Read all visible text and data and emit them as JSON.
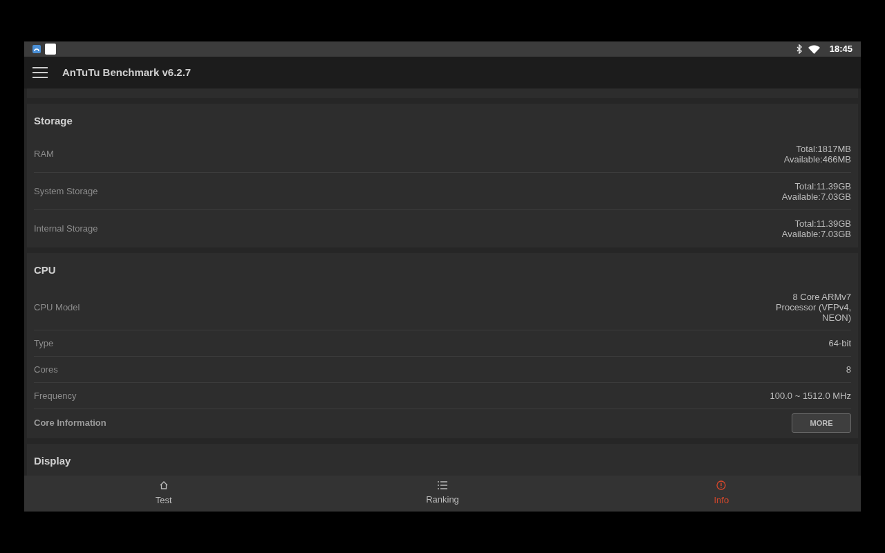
{
  "status_bar": {
    "time": "18:45"
  },
  "app_bar": {
    "title": "AnTuTu Benchmark v6.2.7"
  },
  "sections": [
    {
      "title": "Storage",
      "rows": [
        {
          "kind": "value",
          "label": "RAM",
          "value": [
            "Total:1817MB",
            "Available:466MB"
          ]
        },
        {
          "kind": "value",
          "label": "System Storage",
          "value": [
            "Total:11.39GB",
            "Available:7.03GB"
          ]
        },
        {
          "kind": "value",
          "label": "Internal Storage",
          "value": [
            "Total:11.39GB",
            "Available:7.03GB"
          ]
        }
      ]
    },
    {
      "title": "CPU",
      "rows": [
        {
          "kind": "value",
          "label": "CPU Model",
          "value": [
            "8 Core ARMv7",
            "Processor (VFPv4,",
            "NEON)"
          ]
        },
        {
          "kind": "value",
          "label": "Type",
          "value": [
            "64-bit"
          ]
        },
        {
          "kind": "value",
          "label": "Cores",
          "value": [
            "8"
          ]
        },
        {
          "kind": "value",
          "label": "Frequency",
          "value": [
            "100.0 ~ 1512.0 MHz"
          ]
        },
        {
          "kind": "button",
          "label": "Core Information",
          "button": "MORE"
        }
      ]
    },
    {
      "title": "Display"
    }
  ],
  "bottom_nav": [
    {
      "label": "Test",
      "kind": "home",
      "selected": false
    },
    {
      "label": "Ranking",
      "kind": "list",
      "selected": false
    },
    {
      "label": "Info",
      "kind": "info",
      "selected": true
    }
  ]
}
